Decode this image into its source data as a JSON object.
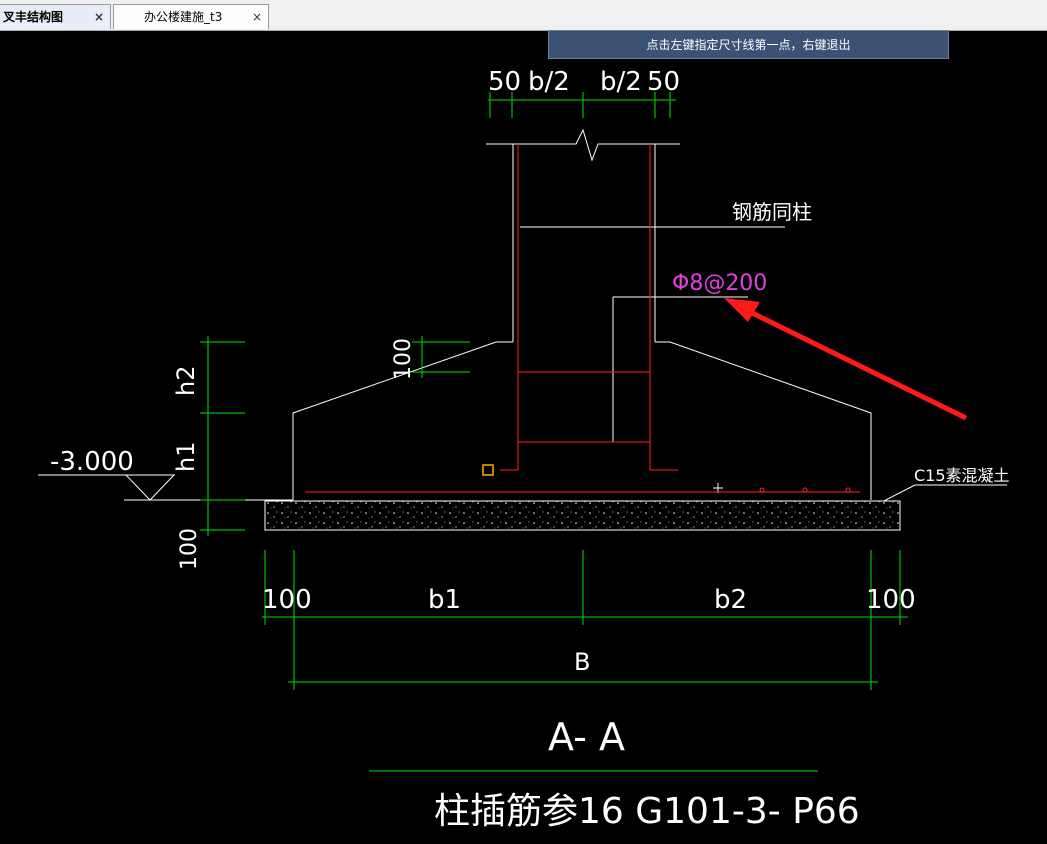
{
  "tabs": [
    {
      "label": "叉丰结构图",
      "close": "×"
    },
    {
      "label": "办公楼建施_t3",
      "close": "×"
    }
  ],
  "hint": "点击左键指定尺寸线第一点，右键退出",
  "drawing": {
    "dims_top": [
      "50",
      "b/2",
      "b/2",
      "50"
    ],
    "rebar_note": "钢筋同柱",
    "stirrup_note": "Φ8@200",
    "dim_100_mid": "100",
    "h2": "h2",
    "h1": "h1",
    "elevation": "-3.000",
    "dim_100_left": "100",
    "concrete_note": "C15素混凝土",
    "dims_bottom": [
      "100",
      "b1",
      "b2",
      "100"
    ],
    "dim_B": "B",
    "section_title": "A- A",
    "reference": "柱插筋参16 G101-3- P66"
  },
  "colors": {
    "line": "#ffffff",
    "dim": "#00e000",
    "rebar": "#ff2020",
    "stirrup_text": "#e040e0",
    "arrow": "#ff1a1a",
    "hint_bg": "#3b5275"
  }
}
